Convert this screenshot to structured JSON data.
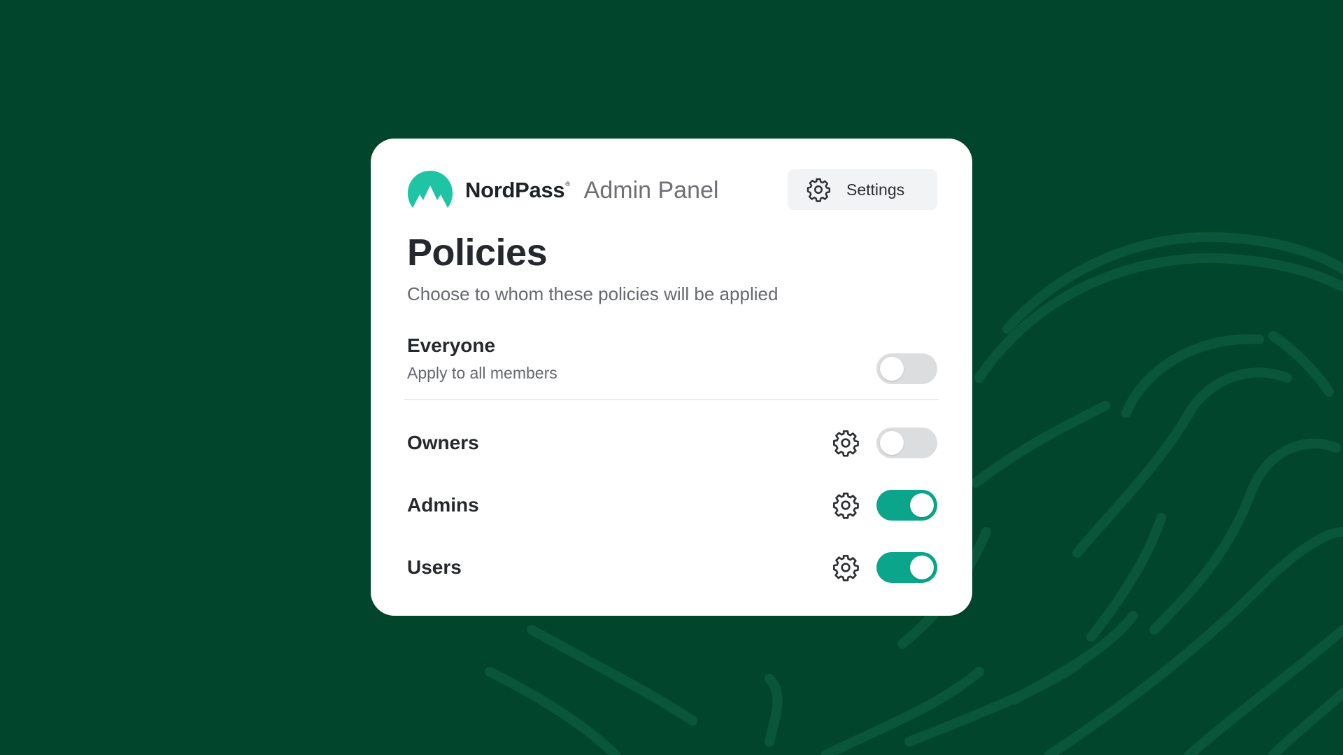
{
  "header": {
    "brand": "NordPass",
    "registered_mark": "®",
    "panel_title": "Admin Panel",
    "settings_label": "Settings",
    "settings_icon": "gear-icon"
  },
  "page": {
    "title": "Policies",
    "subtitle": "Choose to whom these policies will be applied"
  },
  "everyone": {
    "label": "Everyone",
    "sub": "Apply to all members",
    "enabled": false
  },
  "groups": [
    {
      "label": "Owners",
      "enabled": false,
      "icon": "gear-icon"
    },
    {
      "label": "Admins",
      "enabled": true,
      "icon": "gear-icon"
    },
    {
      "label": "Users",
      "enabled": true,
      "icon": "gear-icon"
    }
  ],
  "colors": {
    "background": "#01452c",
    "accent": "#0aa58a",
    "logo": "#1ec4a3",
    "toggle_off": "#dcdddf"
  }
}
